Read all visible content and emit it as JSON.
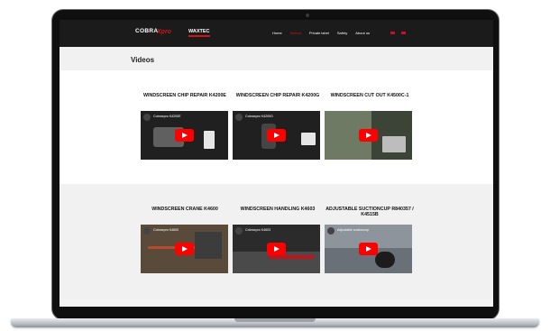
{
  "header": {
    "logo_cobra": "COBRA",
    "logo_xpro": "Xpro",
    "logo_brand": "WAXTEC",
    "nav": [
      "Home",
      "Videos",
      "Private label",
      "Safety",
      "About us"
    ],
    "active_nav": "Videos"
  },
  "page": {
    "title": "Videos"
  },
  "videos": [
    {
      "title": "WINDSCREEN CHIP REPAIR K4200E",
      "thumb_text": "Cobraxpro K4200E"
    },
    {
      "title": "WINDSCREEN CHIP REPAIR K4200G",
      "thumb_text": "Cobraxpro K4200G"
    },
    {
      "title": "WINDSCREEN CUT OUT K4500C-1",
      "thumb_text": ""
    },
    {
      "title": "WINDSCREEN CRANE K4600",
      "thumb_text": "Cobraxpro K4600"
    },
    {
      "title": "WINDSCREEN HANDLING K4603",
      "thumb_text": "Cobraxpro K4603"
    },
    {
      "title": "ADJUSTABLE SUCTIONCUP R840357 / K4515B",
      "thumb_text": "Adjustable suctioncup"
    }
  ],
  "colors": {
    "accent": "#d3141b",
    "topbar": "#1b1b1b",
    "youtube_red": "#ff0000"
  },
  "icons": [
    "play-button-icon",
    "flag-icon"
  ]
}
